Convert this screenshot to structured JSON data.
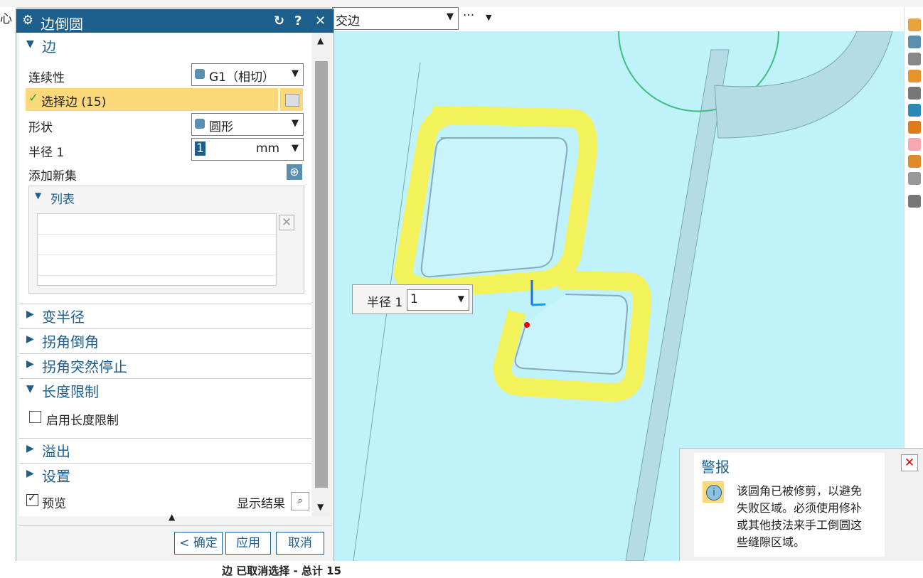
{
  "left_edge_text": "心",
  "dialog": {
    "title": "边倒圆",
    "sections": {
      "edge": "边",
      "variable_radius": "变半径",
      "corner_setback": "拐角倒角",
      "corner_stop": "拐角突然停止",
      "length_limit": "长度限制",
      "overflow": "溢出",
      "settings": "设置"
    },
    "continuity_label": "连续性",
    "continuity_value": "G1（相切）",
    "select_edge": "选择边 (15)",
    "shape_label": "形状",
    "shape_value": "圆形",
    "radius_label": "半径 1",
    "radius_value": "1",
    "radius_unit": "mm",
    "add_new_set": "添加新集",
    "list_label": "列表",
    "enable_length_limit": "启用长度限制",
    "preview": "预览",
    "show_result": "显示结果",
    "ok_button": "< 确定 >",
    "apply_button": "应用",
    "cancel_button": "取消"
  },
  "viewport": {
    "filter_value": "交边",
    "more_button": "···",
    "radius_popup_label": "半径 1",
    "radius_popup_value": "1"
  },
  "alert": {
    "title": "警报",
    "message_lines": [
      "该圆角已被修剪，以避免",
      "失败区域。必须使用修补",
      "或其他技法来手工倒圆这",
      "些缝隙区域。"
    ]
  },
  "status_text": "边 已取消选择 - 总计 15",
  "colors": {
    "accent": "#1c5f8c",
    "selection": "#fbd97a",
    "viewport": "#bff2fa",
    "fillet": "#f4f25a"
  }
}
